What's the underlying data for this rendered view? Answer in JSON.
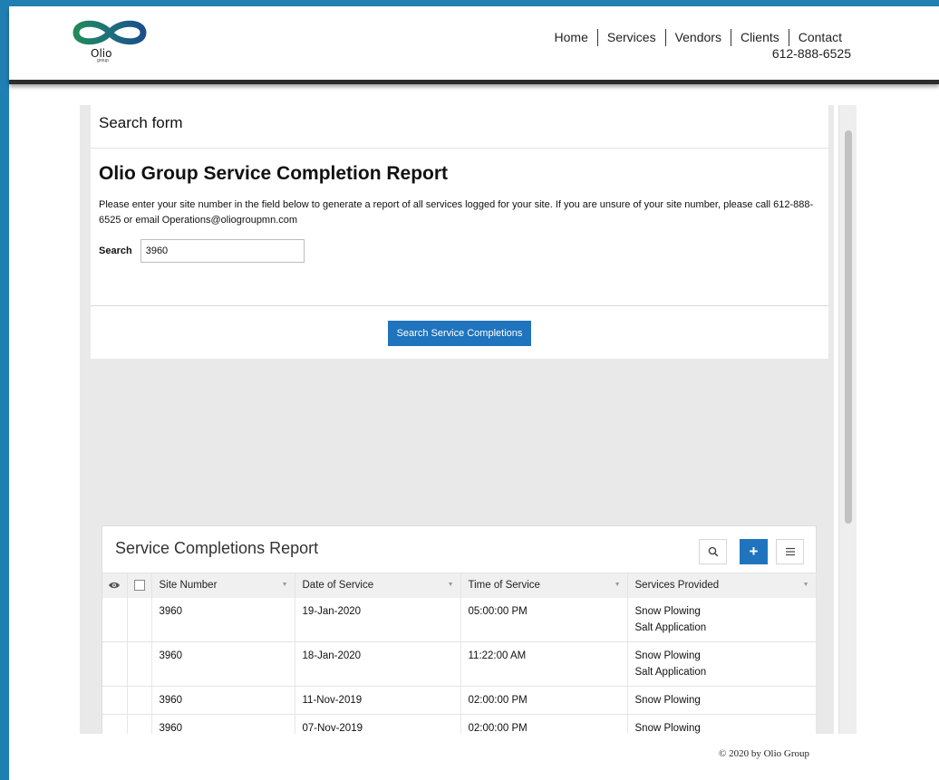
{
  "header": {
    "logo": {
      "word": "Olio",
      "sub": "group"
    },
    "nav": [
      "Home",
      "Services",
      "Vendors",
      "Clients",
      "Contact"
    ],
    "phone": "612-888-6525"
  },
  "form": {
    "header": "Search form",
    "title": "Olio Group Service Completion Report",
    "description": "Please enter your site number in the field below to generate a report of all services logged for your site. If you are unsure of your site number, please call 612-888-6525 or email Operations@oliogroupmn.com",
    "search_label": "Search",
    "search_value": "3960",
    "button_label": "Search Service Completions"
  },
  "report": {
    "title": "Service Completions Report",
    "columns": [
      "Site Number",
      "Date of Service",
      "Time of Service",
      "Services Provided"
    ],
    "rows": [
      {
        "site": "3960",
        "date": "19-Jan-2020",
        "time": "05:00:00 PM",
        "services": [
          "Snow Plowing",
          "Salt Application"
        ]
      },
      {
        "site": "3960",
        "date": "18-Jan-2020",
        "time": "11:22:00 AM",
        "services": [
          "Snow Plowing",
          "Salt Application"
        ]
      },
      {
        "site": "3960",
        "date": "11-Nov-2019",
        "time": "02:00:00 PM",
        "services": [
          "Snow Plowing"
        ]
      },
      {
        "site": "3960",
        "date": "07-Nov-2019",
        "time": "02:00:00 PM",
        "services": [
          "Snow Plowing"
        ]
      }
    ],
    "toolbar": {
      "search_icon": "search-icon",
      "add_icon": "plus-icon",
      "menu_icon": "menu-icon",
      "add_label": "+"
    },
    "header_icons": {
      "visibility": "eye-icon"
    }
  },
  "footer": {
    "copyright": "© 2020 by Olio Group"
  },
  "colors": {
    "frame": "#1f7fb0",
    "accent": "#1f74bd",
    "header_border": "#2c2c2c",
    "logo_green": "#1f8a5a",
    "logo_blue": "#1b4f8a"
  }
}
